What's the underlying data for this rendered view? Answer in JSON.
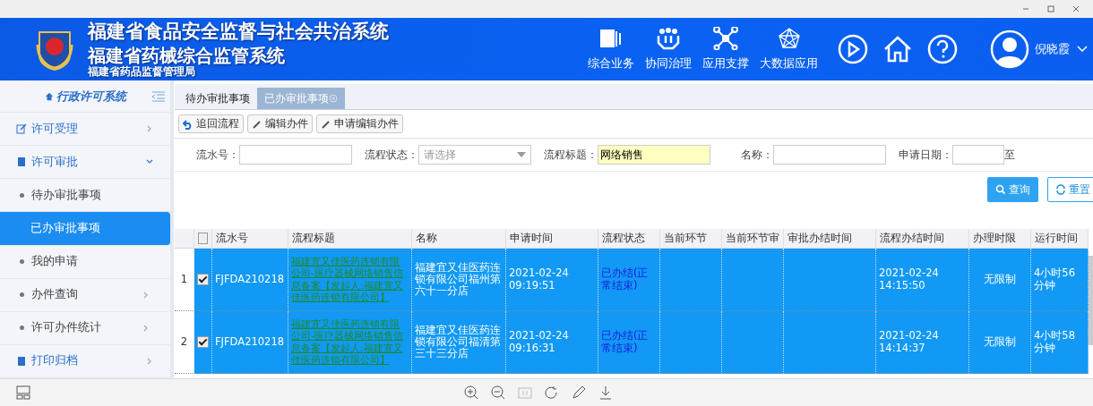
{
  "header": {
    "titles": [
      "福建省食品安全监督与社会共治系统",
      "福建省药械综合监管系统",
      "福建省药品监督管理局"
    ],
    "nav": [
      {
        "label": "综合业务",
        "kind": "cards"
      },
      {
        "label": "协同治理",
        "kind": "people"
      },
      {
        "label": "应用支撑",
        "kind": "hub"
      },
      {
        "label": "大数据应用",
        "kind": "network"
      }
    ],
    "user": "倪晓霞"
  },
  "sidebar": {
    "title": "行政许可系统",
    "items": [
      {
        "label": "许可受理",
        "kind": "group",
        "expanded": false
      },
      {
        "label": "许可审批",
        "kind": "group",
        "expanded": true,
        "children": [
          {
            "label": "待办审批事项",
            "selected": false,
            "arrow": false
          },
          {
            "label": "已办审批事项",
            "selected": true,
            "arrow": false
          },
          {
            "label": "我的申请",
            "selected": false,
            "arrow": false
          },
          {
            "label": "办件查询",
            "selected": false,
            "arrow": true
          },
          {
            "label": "许可办件统计",
            "selected": false,
            "arrow": true
          }
        ]
      },
      {
        "label": "打印归档",
        "kind": "group",
        "expanded": false
      }
    ]
  },
  "tabs": [
    {
      "label": "待办审批事项",
      "selected": false
    },
    {
      "label": "已办审批事项",
      "selected": true
    }
  ],
  "toolbar": [
    {
      "label": "追回流程",
      "kind": "back"
    },
    {
      "label": "编辑办件",
      "kind": "pen"
    },
    {
      "label": "申请编辑办件",
      "kind": "pen"
    }
  ],
  "filters": [
    {
      "label": "流水号：",
      "kind": "text"
    },
    {
      "label": "流程状态：",
      "kind": "select",
      "placeholder": "请选择"
    },
    {
      "label": "流程标题：",
      "kind": "text",
      "value": "网络销售"
    },
    {
      "label": "名称：",
      "kind": "text"
    },
    {
      "label": "申请日期：",
      "kind": "date",
      "suffix": "至"
    }
  ],
  "actions": [
    {
      "label": "查询",
      "kind": "search"
    },
    {
      "label": "重置",
      "kind": "reset"
    }
  ],
  "table": {
    "header_checked": false,
    "columns": [
      "流水号",
      "流程标题",
      "名称",
      "申请时间",
      "流程状态",
      "当前环节",
      "当前环节审",
      "审批办结时间",
      "流程办结时间",
      "办理时限",
      "运行时间"
    ],
    "rows": [
      {
        "index": "1",
        "selected": true,
        "checked": true,
        "serial": "FJFDA210218",
        "title": "福建宜又佳医药连锁有限公司-医疗器械网络销售信息备案【发起人:福建宜又佳医药连锁有限公司】",
        "name": "福建宜又佳医药连锁有限公司福州第六十一分店",
        "applied": "2021-02-24 09:19:51",
        "status": "已办结(正常结束)",
        "finished": "2021-02-24 14:15:50",
        "limit": "无限制",
        "runtime": "4小时56分钟"
      },
      {
        "index": "2",
        "selected": true,
        "checked": true,
        "serial": "FJFDA210218",
        "title": "福建宜又佳医药连锁有限公司-医疗器械网络销售信息备案【发起人:福建宜又佳医药连锁有限公司】",
        "name": "福建宜又佳医药连锁有限公司福清第三十三分店",
        "applied": "2021-02-24 09:16:31",
        "status": "已办结(正常结束)",
        "finished": "2021-02-24 14:14:37",
        "limit": "无限制",
        "runtime": "4小时58分钟"
      }
    ]
  }
}
